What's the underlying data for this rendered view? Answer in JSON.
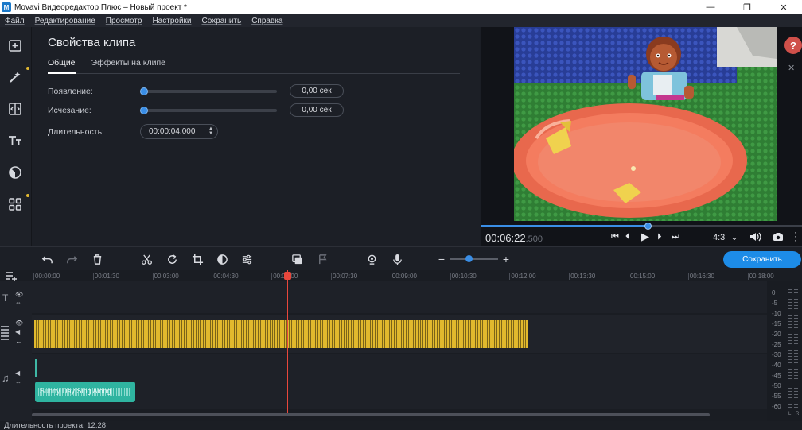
{
  "window": {
    "title": "Movavi Видеоредактор Плюс – Новый проект *",
    "app_icon": "М",
    "controls": [
      "—",
      "❐",
      "✕"
    ]
  },
  "menu": [
    "Файл",
    "Редактирование",
    "Просмотр",
    "Настройки",
    "Сохранить",
    "Справка"
  ],
  "left_tools": [
    {
      "icon": "import-icon",
      "badge": false
    },
    {
      "icon": "magic-wand-icon",
      "badge": true
    },
    {
      "icon": "transitions-icon",
      "badge": false
    },
    {
      "icon": "titles-icon",
      "badge": false
    },
    {
      "icon": "filters-icon",
      "badge": false
    },
    {
      "icon": "more-tools-icon",
      "badge": true
    }
  ],
  "clip_properties": {
    "title": "Свойства клипа",
    "tabs": [
      "Общие",
      "Эффекты на клипе"
    ],
    "active_tab": "Общие",
    "fade_in": {
      "label": "Появление:",
      "value": "0,00 сек",
      "level": 0
    },
    "fade_out": {
      "label": "Исчезание:",
      "value": "0,00 сек",
      "level": 0
    },
    "duration": {
      "label": "Длительность:",
      "value": "00:00:04.000"
    }
  },
  "preview": {
    "help": "?",
    "close": "✕",
    "timecode_main": "00:06:22",
    "timecode_ms": ".500",
    "progress": 0.52,
    "aspect": "4:3",
    "aspect_arrow": "⌄",
    "prev_icon": "⏮",
    "stepback_icon": "⏴",
    "play_icon": "▶",
    "stepfwd_icon": "⏵",
    "next_icon": "⏭"
  },
  "toolbar": {
    "save_label": "Сохранить",
    "zoom_minus": "−",
    "zoom_plus": "+",
    "zoom_level": 0.35
  },
  "ruler_ticks": [
    "00:00:00",
    "00:01:30",
    "00:03:00",
    "00:04:30",
    "00:06:00",
    "00:07:30",
    "00:09:00",
    "00:10:30",
    "00:12:00",
    "00:13:30",
    "00:15:00",
    "00:16:30",
    "00:18:00"
  ],
  "audio_clip": {
    "name": "Sunny Day Sing Along"
  },
  "meter_labels": [
    "0",
    "-5",
    "-10",
    "-15",
    "-20",
    "-25",
    "-30",
    "-40",
    "-45",
    "-50",
    "-55",
    "-60"
  ],
  "meter_channels": [
    "L",
    "R"
  ],
  "status": {
    "text": "Длительность проекта: 12:28"
  }
}
